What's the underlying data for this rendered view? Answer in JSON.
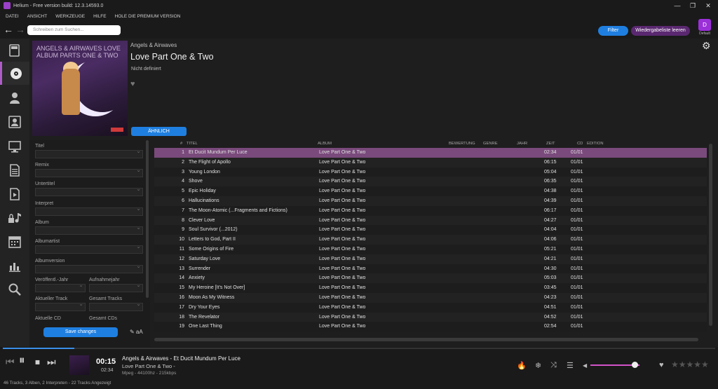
{
  "window": {
    "title": "Helium - Free version build: 12.3.14593.0",
    "minimize": "—",
    "maximize": "❐",
    "close": "✕"
  },
  "menu": [
    "DATEI",
    "ANSICHT",
    "WERKZEUGE",
    "HILFE",
    "HOLE DIE PREMIUM VERSION"
  ],
  "nav": {
    "back": "←",
    "forward": "→",
    "search_placeholder": "Schreiben zum Suchen...",
    "filter": "Filter",
    "queue": "Wiedergabeliste leeren",
    "profile_letter": "D",
    "profile_label": "Default"
  },
  "sidebar_icons": [
    "library-icon",
    "album-icon",
    "artist-icon",
    "contacts-icon",
    "monitor-icon",
    "document-icon",
    "video-icon",
    "locked-music-icon",
    "calendar-icon",
    "stats-icon",
    "search-icon"
  ],
  "album": {
    "artist": "Angels & Airwaves",
    "title": "Love Part One & Two",
    "subtitle": "Nicht definiert",
    "similar_button": "ÄHNLICH",
    "cover_text": "ANGELS & AIRWAVES LOVE ALBUM PARTS ONE & TWO"
  },
  "tags": {
    "fields": [
      "Titel",
      "Remix",
      "Untertitel",
      "Interpret",
      "Album",
      "Albumartist",
      "Albumversion"
    ],
    "veroeffentl": "Veröffentl.-Jahr",
    "aufnahmejahr": "Aufnahmejahr",
    "aktueller_track": "Aktueller Track",
    "gesamt_tracks": "Gesamt Tracks",
    "aktuelle_cd": "Aktuelle CD",
    "gesamt_cds": "Gesamt CDs",
    "save": "Save changes",
    "tools": "✎ aA"
  },
  "columns": {
    "num": "#",
    "title": "TITEL",
    "album": "ALBUM",
    "rating": "BEWERTUNG",
    "genre": "GENRE",
    "year": "JAHR",
    "time": "ZEIT",
    "cd": "CD",
    "edition": "EDITION"
  },
  "tracks": [
    {
      "num": "1",
      "title": "Et Ducit Mundum Per Luce",
      "album": "Love Part One & Two",
      "time": "02:34",
      "cd": "01/01"
    },
    {
      "num": "2",
      "title": "The Flight of Apollo",
      "album": "Love Part One & Two",
      "time": "06:15",
      "cd": "01/01"
    },
    {
      "num": "3",
      "title": "Young London",
      "album": "Love Part One & Two",
      "time": "05:04",
      "cd": "01/01"
    },
    {
      "num": "4",
      "title": "Shove",
      "album": "Love Part One & Two",
      "time": "06:35",
      "cd": "01/01"
    },
    {
      "num": "5",
      "title": "Epic Holiday",
      "album": "Love Part One & Two",
      "time": "04:38",
      "cd": "01/01"
    },
    {
      "num": "6",
      "title": "Hallucinations",
      "album": "Love Part One & Two",
      "time": "04:39",
      "cd": "01/01"
    },
    {
      "num": "7",
      "title": "The Moon-Atomic (...Fragments and Fictions)",
      "album": "Love Part One & Two",
      "time": "06:17",
      "cd": "01/01"
    },
    {
      "num": "8",
      "title": "Clever Love",
      "album": "Love Part One & Two",
      "time": "04:27",
      "cd": "01/01"
    },
    {
      "num": "9",
      "title": "Soul Survivor (...2012)",
      "album": "Love Part One & Two",
      "time": "04:04",
      "cd": "01/01"
    },
    {
      "num": "10",
      "title": "Letters to God, Part II",
      "album": "Love Part One & Two",
      "time": "04:06",
      "cd": "01/01"
    },
    {
      "num": "11",
      "title": "Some Origins of Fire",
      "album": "Love Part One & Two",
      "time": "05:21",
      "cd": "01/01"
    },
    {
      "num": "12",
      "title": "Saturday Love",
      "album": "Love Part One & Two",
      "time": "04:21",
      "cd": "01/01"
    },
    {
      "num": "13",
      "title": "Surrender",
      "album": "Love Part One & Two",
      "time": "04:30",
      "cd": "01/01"
    },
    {
      "num": "14",
      "title": "Anxiety",
      "album": "Love Part One & Two",
      "time": "05:03",
      "cd": "01/01"
    },
    {
      "num": "15",
      "title": "My Heroine [It's Not Over]",
      "album": "Love Part One & Two",
      "time": "03:45",
      "cd": "01/01"
    },
    {
      "num": "16",
      "title": "Moon As My Witness",
      "album": "Love Part One & Two",
      "time": "04:23",
      "cd": "01/01"
    },
    {
      "num": "17",
      "title": "Dry Your Eyes",
      "album": "Love Part One & Two",
      "time": "04:51",
      "cd": "01/01"
    },
    {
      "num": "18",
      "title": "The Revelator",
      "album": "Love Part One & Two",
      "time": "04:52",
      "cd": "01/01"
    },
    {
      "num": "19",
      "title": "One Last Thing",
      "album": "Love Part One & Two",
      "time": "02:54",
      "cd": "01/01"
    }
  ],
  "player": {
    "elapsed": "00:15",
    "total": "02:34",
    "now_title": "Angels & Airwaves - Et Ducit Mundum Per Luce",
    "now_album": "Love Part One & Two -",
    "now_format": "Mpeg - 44100hz - 215kbps",
    "progress": 0.1,
    "volume": 0.9
  },
  "status": "46 Tracks, 3 Alben, 2 Interpreten - 22 Tracks Angezeigt",
  "colors": {
    "accent": "#1f7fe0",
    "selected_row": "#7a4a7c",
    "volume": "#d252c8",
    "sidebar_active": "#b05cc8"
  }
}
